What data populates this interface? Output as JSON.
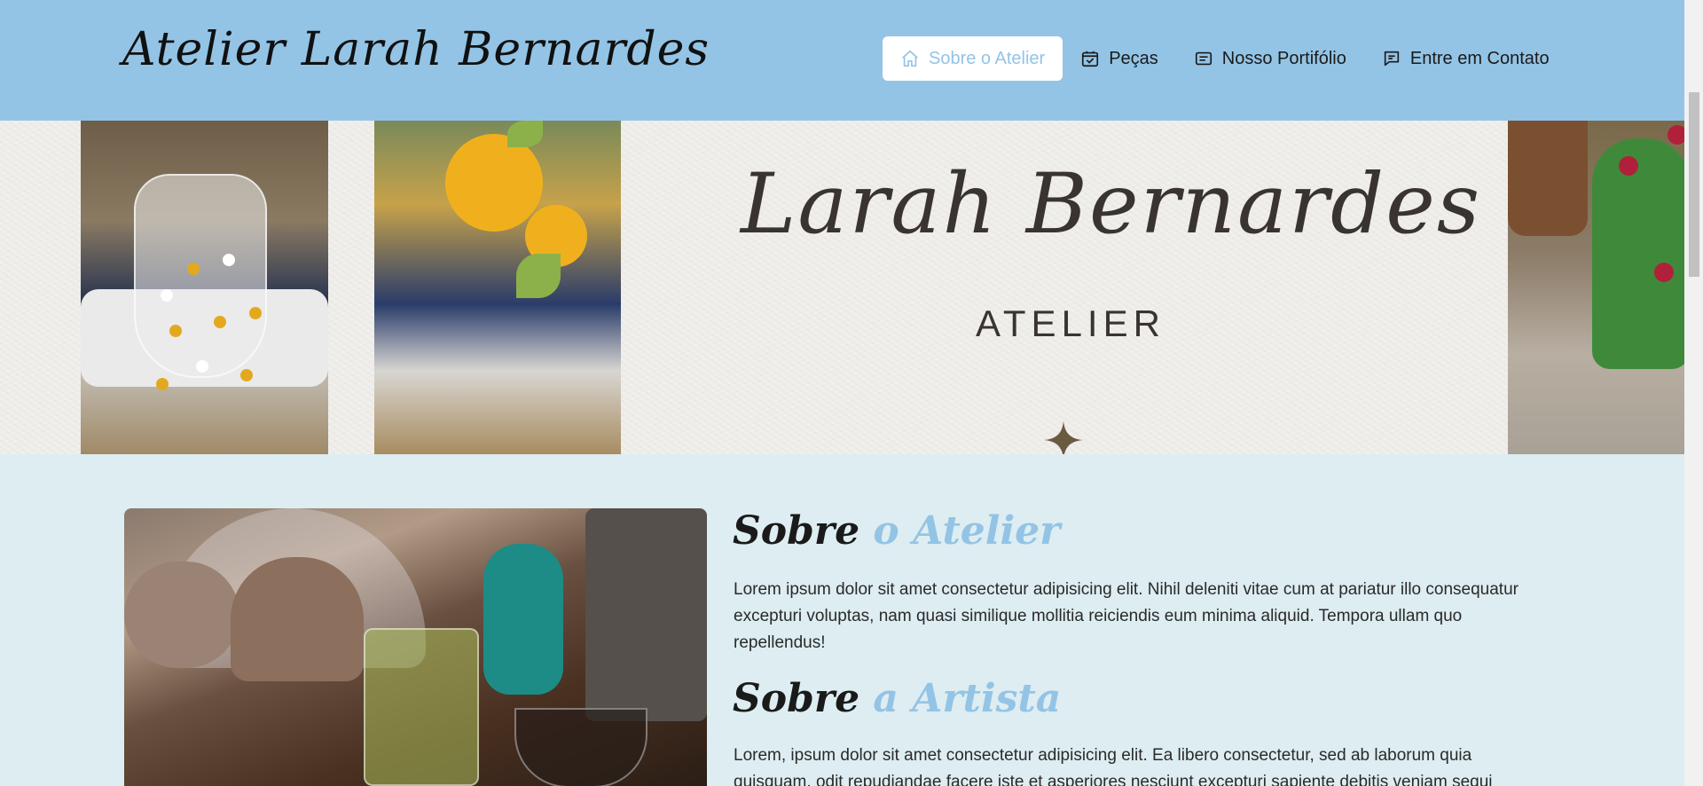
{
  "header": {
    "brand": "Atelier Larah Bernardes",
    "nav": [
      {
        "label": "Sobre o Atelier",
        "icon": "home-icon",
        "active": true
      },
      {
        "label": "Peças",
        "icon": "calendar-check-icon",
        "active": false
      },
      {
        "label": "Nosso Portifólio",
        "icon": "document-text-icon",
        "active": false
      },
      {
        "label": "Entre em Contato",
        "icon": "chat-bubble-icon",
        "active": false
      }
    ]
  },
  "hero": {
    "title": "Larah Bernardes",
    "subtitle": "ATELIER"
  },
  "about": {
    "atelier_title_main": "Sobre",
    "atelier_title_accent": "o Atelier",
    "atelier_text": "Lorem ipsum dolor sit amet consectetur adipisicing elit. Nihil deleniti vitae cum at pariatur illo consequatur excepturi voluptas, nam quasi similique mollitia reiciendis eum minima aliquid. Tempora ullam quo repellendus!",
    "artist_title_main": "Sobre",
    "artist_title_accent": "a Artista",
    "artist_text": "Lorem, ipsum dolor sit amet consectetur adipisicing elit. Ea libero consectetur, sed ab laborum quia quisquam, odit repudiandae facere iste et asperiores nesciunt excepturi sapiente debitis veniam sequi"
  },
  "colors": {
    "header_bg": "#93c4e6",
    "accent": "#93c4e6",
    "section_bg": "#ddedf1"
  }
}
